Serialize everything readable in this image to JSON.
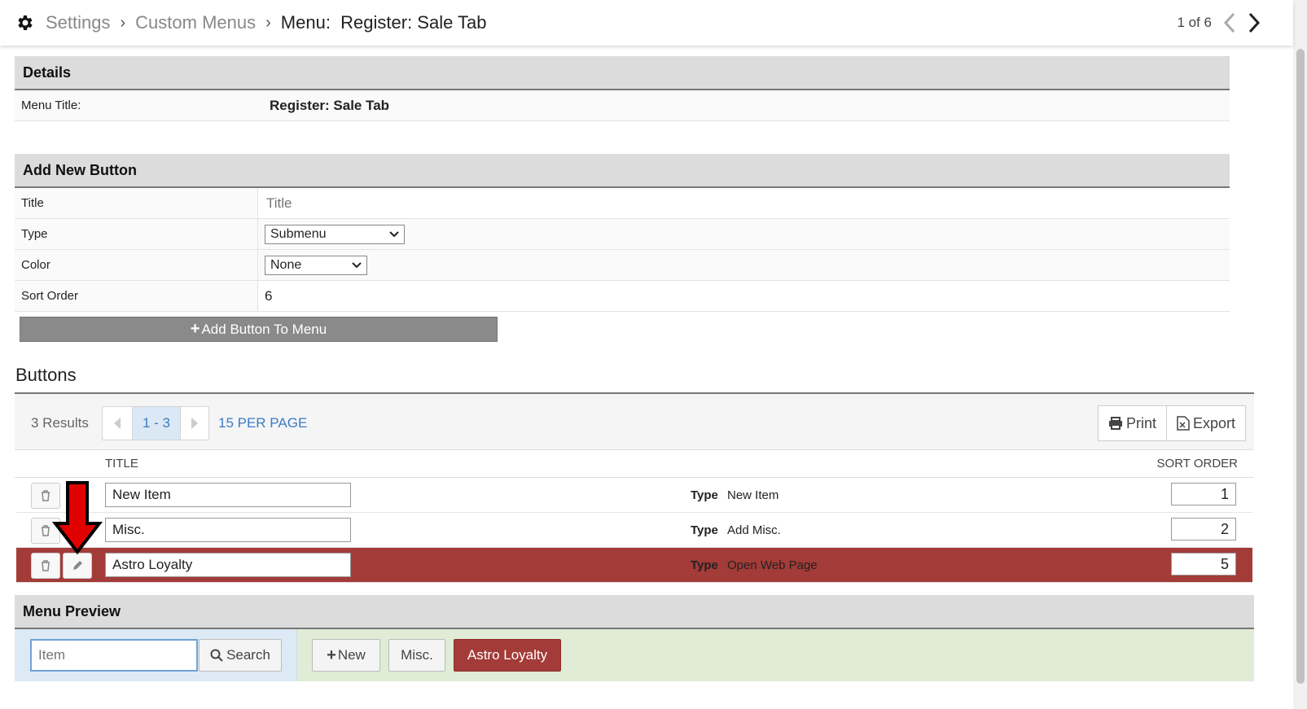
{
  "breadcrumb": {
    "root": "Settings",
    "parent": "Custom Menus",
    "current": "Menu:  Register: Sale Tab"
  },
  "pager": {
    "text": "1 of 6"
  },
  "details": {
    "heading": "Details",
    "menu_title_label": "Menu Title:",
    "menu_title_value": "Register: Sale Tab"
  },
  "add_new": {
    "heading": "Add New Button",
    "title_label": "Title",
    "title_placeholder": "Title",
    "type_label": "Type",
    "type_value": "Submenu",
    "color_label": "Color",
    "color_value": "None",
    "sort_label": "Sort Order",
    "sort_value": "6",
    "add_button": "Add Button To Menu"
  },
  "buttons": {
    "heading": "Buttons",
    "results": "3 Results",
    "page_range": "1 - 3",
    "per_page": "15 PER PAGE",
    "print": "Print",
    "export": "Export",
    "col_title": "TITLE",
    "col_sort": "SORT ORDER",
    "type_label": "Type",
    "rows": [
      {
        "title": "New Item",
        "type": "New Item",
        "sort": "1"
      },
      {
        "title": "Misc.",
        "type": "Add Misc.",
        "sort": "2"
      },
      {
        "title": "Astro Loyalty",
        "type": "Open Web Page",
        "sort": "5"
      }
    ]
  },
  "preview": {
    "heading": "Menu Preview",
    "item_placeholder": "Item",
    "search": "Search",
    "new": "New",
    "misc": "Misc.",
    "astro": "Astro Loyalty"
  },
  "colors": {
    "selected_row": "#a33b38",
    "link": "#3a7bc8",
    "arrow": "#e00000"
  }
}
